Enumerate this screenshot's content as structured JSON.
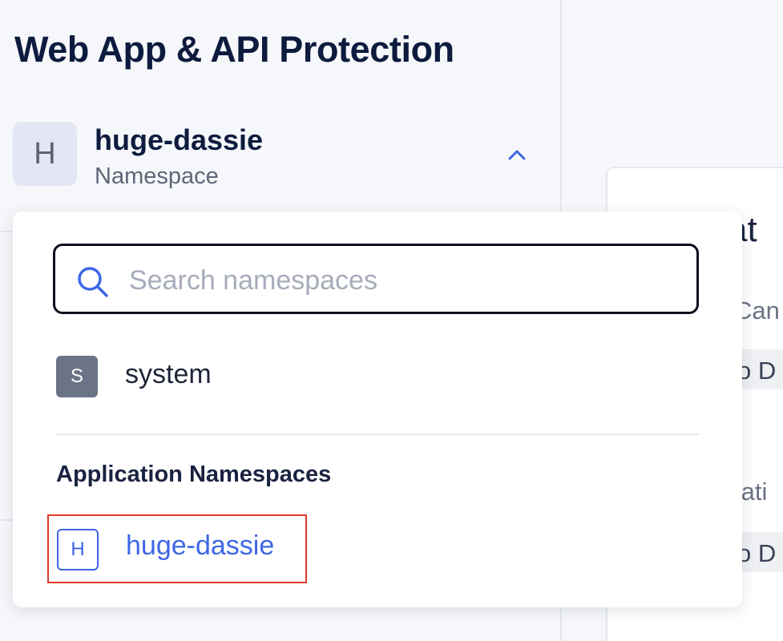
{
  "app": {
    "title": "Web App & API Protection"
  },
  "namespace_selector": {
    "avatar_letter": "H",
    "current_name": "huge-dassie",
    "type_label": "Namespace",
    "expanded": true
  },
  "dropdown": {
    "search": {
      "placeholder": "Search namespaces",
      "value": ""
    },
    "system_item": {
      "badge": "S",
      "label": "system"
    },
    "section_label": "Application Namespaces",
    "application_items": [
      {
        "badge": "H",
        "label": "huge-dassie",
        "selected": true
      }
    ]
  },
  "background_content": {
    "heading_fragment": "at",
    "line1_fragment": "Can",
    "chip1_fragment": "o D",
    "line2_fragment": "tati",
    "chip2_fragment": "o D"
  },
  "colors": {
    "accent": "#3e67e6",
    "highlight_border": "#e03b2b",
    "title_text": "#0d1b3e",
    "system_badge": "#6b7487"
  },
  "icons": {
    "search": "search-icon",
    "chevron": "chevron-up-icon"
  }
}
